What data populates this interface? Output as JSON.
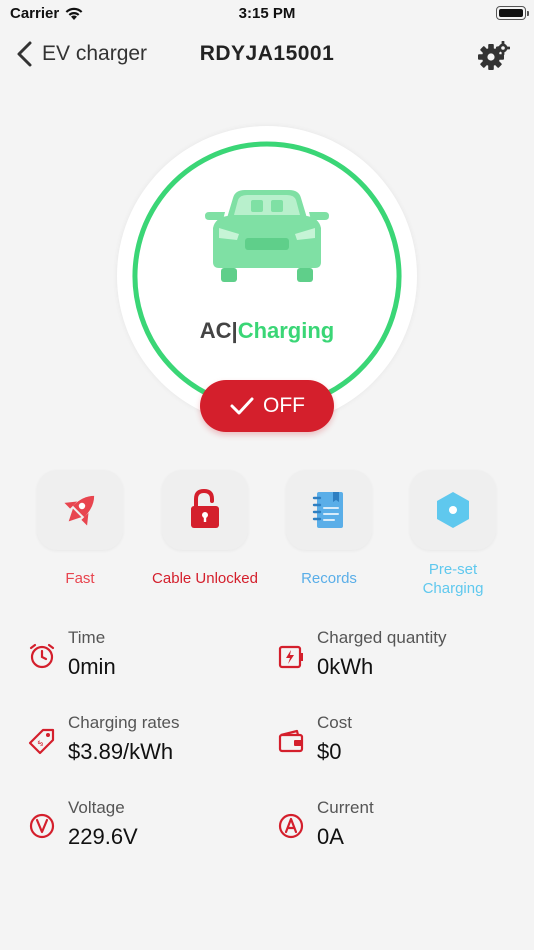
{
  "status_bar": {
    "carrier": "Carrier",
    "time": "3:15 PM"
  },
  "nav": {
    "back_label": "EV charger",
    "title": "RDYJA15001"
  },
  "gauge": {
    "mode": "AC|",
    "status": "Charging",
    "progress_fraction": 0.9
  },
  "off_button": {
    "label": "OFF"
  },
  "actions": [
    {
      "label": "Fast",
      "icon": "rocket-icon",
      "color": "#e8454f"
    },
    {
      "label": "Cable Unlocked",
      "icon": "unlocked-padlock-icon",
      "color": "#d41f2c"
    },
    {
      "label": "Records",
      "icon": "notebook-icon",
      "color": "#5aaee8"
    },
    {
      "label_line1": "Pre-set",
      "label_line2": "Charging",
      "icon": "hexagon-icon",
      "color": "#5fc8ee"
    }
  ],
  "info": {
    "time": {
      "label": "Time",
      "value": "0min",
      "icon": "alarm-clock-icon"
    },
    "charged_quantity": {
      "label": "Charged quantity",
      "value": "0kWh",
      "icon": "battery-bolt-icon"
    },
    "charging_rates": {
      "label": "Charging rates",
      "value": "$3.89/kWh",
      "icon": "price-tag-icon"
    },
    "cost": {
      "label": "Cost",
      "value": "$0",
      "icon": "wallet-icon"
    },
    "voltage": {
      "label": "Voltage",
      "value": "229.6V",
      "icon": "voltage-icon"
    },
    "current": {
      "label": "Current",
      "value": "0A",
      "icon": "ampere-icon"
    }
  },
  "colors": {
    "accent_red": "#d41f2c",
    "charging_green": "#3ad676",
    "background": "#f4f4f4"
  }
}
